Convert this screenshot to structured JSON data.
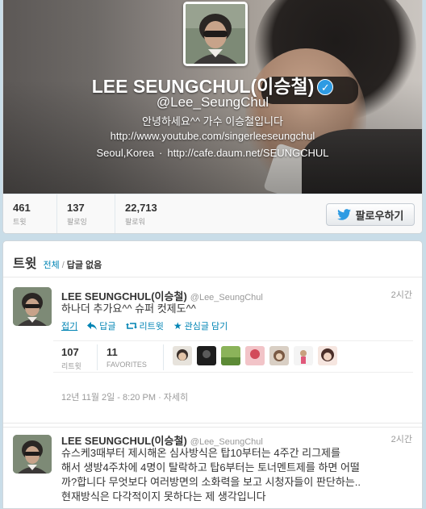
{
  "profile": {
    "name": "LEE SEUNGCHUL(이승철)",
    "verified_mark": "✓",
    "handle": "@Lee_SeungChul",
    "bio": "안녕하세요^^ 가수 이승철입니다",
    "url": "http://www.youtube.com/singerleeseungchul",
    "location": "Seoul,Korea",
    "location_sep": "·",
    "cafe_url": "http://cafe.daum.net/SEUNGCHUL"
  },
  "stats": {
    "tweets": {
      "value": "461",
      "label": "트윗"
    },
    "following": {
      "value": "137",
      "label": "팔로잉"
    },
    "followers": {
      "value": "22,713",
      "label": "팔로워"
    }
  },
  "follow_button": {
    "label": "팔로우하기",
    "icon": "twitter-bird-icon"
  },
  "tweets_section": {
    "title": "트윗",
    "filter_all": "전체",
    "filter_sep": "/",
    "filter_no_replies": "답글 없음"
  },
  "tweets": [
    {
      "name": "LEE SEUNGCHUL(이승철)",
      "handle": "@Lee_SeungChul",
      "time": "2시간",
      "text": "하나더 추가요^^ 슈퍼 컷제도^^",
      "actions": {
        "collapse": "접기",
        "reply": "답글",
        "retweet": "리트윗",
        "favorite": "관심글 담기"
      },
      "retweets": {
        "value": "107",
        "label": "리트윗"
      },
      "favorites": {
        "value": "11",
        "label": "FAVORITES"
      },
      "date": "12년 11월 2일 - 8:20 PM",
      "date_sep": "·",
      "details": "자세히"
    },
    {
      "name": "LEE SEUNGCHUL(이승철)",
      "handle": "@Lee_SeungChul",
      "time": "2시간",
      "text_lines": [
        "슈스케3때부터 제시해온 심사방식은 탑10부터는 4주간 리그제를",
        "해서 생방4주차에 4명이 탈락하고 탑6부터는 토너멘트제를 하면 어떨",
        "까?합니다 무엇보다 여러방면의 소화력을 보고 시청자들이 판단하는..",
        "현재방식은 다각적이지 못하다는 제 생각입니다"
      ]
    }
  ],
  "colors": {
    "link": "#0084b4",
    "verified": "#2e9be3",
    "background": "#c9dde8"
  }
}
